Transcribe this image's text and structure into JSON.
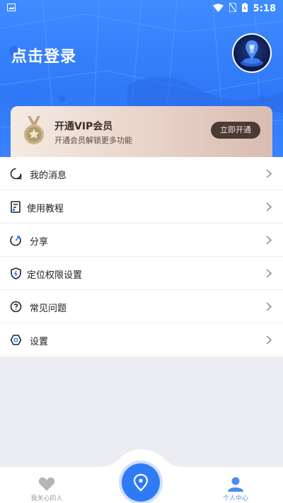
{
  "status_bar": {
    "time": "5:18"
  },
  "header": {
    "login_title": "点击登录"
  },
  "vip": {
    "title": "开通VIP会员",
    "subtitle": "开通会员解锁更多功能",
    "button_label": "立即开通"
  },
  "menu": {
    "items": [
      {
        "label": "我的消息",
        "icon": "message-icon"
      },
      {
        "label": "使用教程",
        "icon": "tutorial-icon"
      },
      {
        "label": "分享",
        "icon": "share-icon"
      },
      {
        "label": "定位权限设置",
        "icon": "shield-icon"
      },
      {
        "label": "常见问题",
        "icon": "question-icon"
      },
      {
        "label": "设置",
        "icon": "gear-icon"
      }
    ]
  },
  "bottom_nav": {
    "items": [
      {
        "label": "我关心的人",
        "icon": "heart-icon",
        "active": false
      },
      {
        "label": "",
        "icon": "location-pin-icon",
        "active": false
      },
      {
        "label": "个人中心",
        "icon": "user-icon",
        "active": true
      }
    ]
  },
  "colors": {
    "primary": "#2f7bf6",
    "vip_button": "#4b3b35",
    "active_nav": "#5d8ff2"
  }
}
